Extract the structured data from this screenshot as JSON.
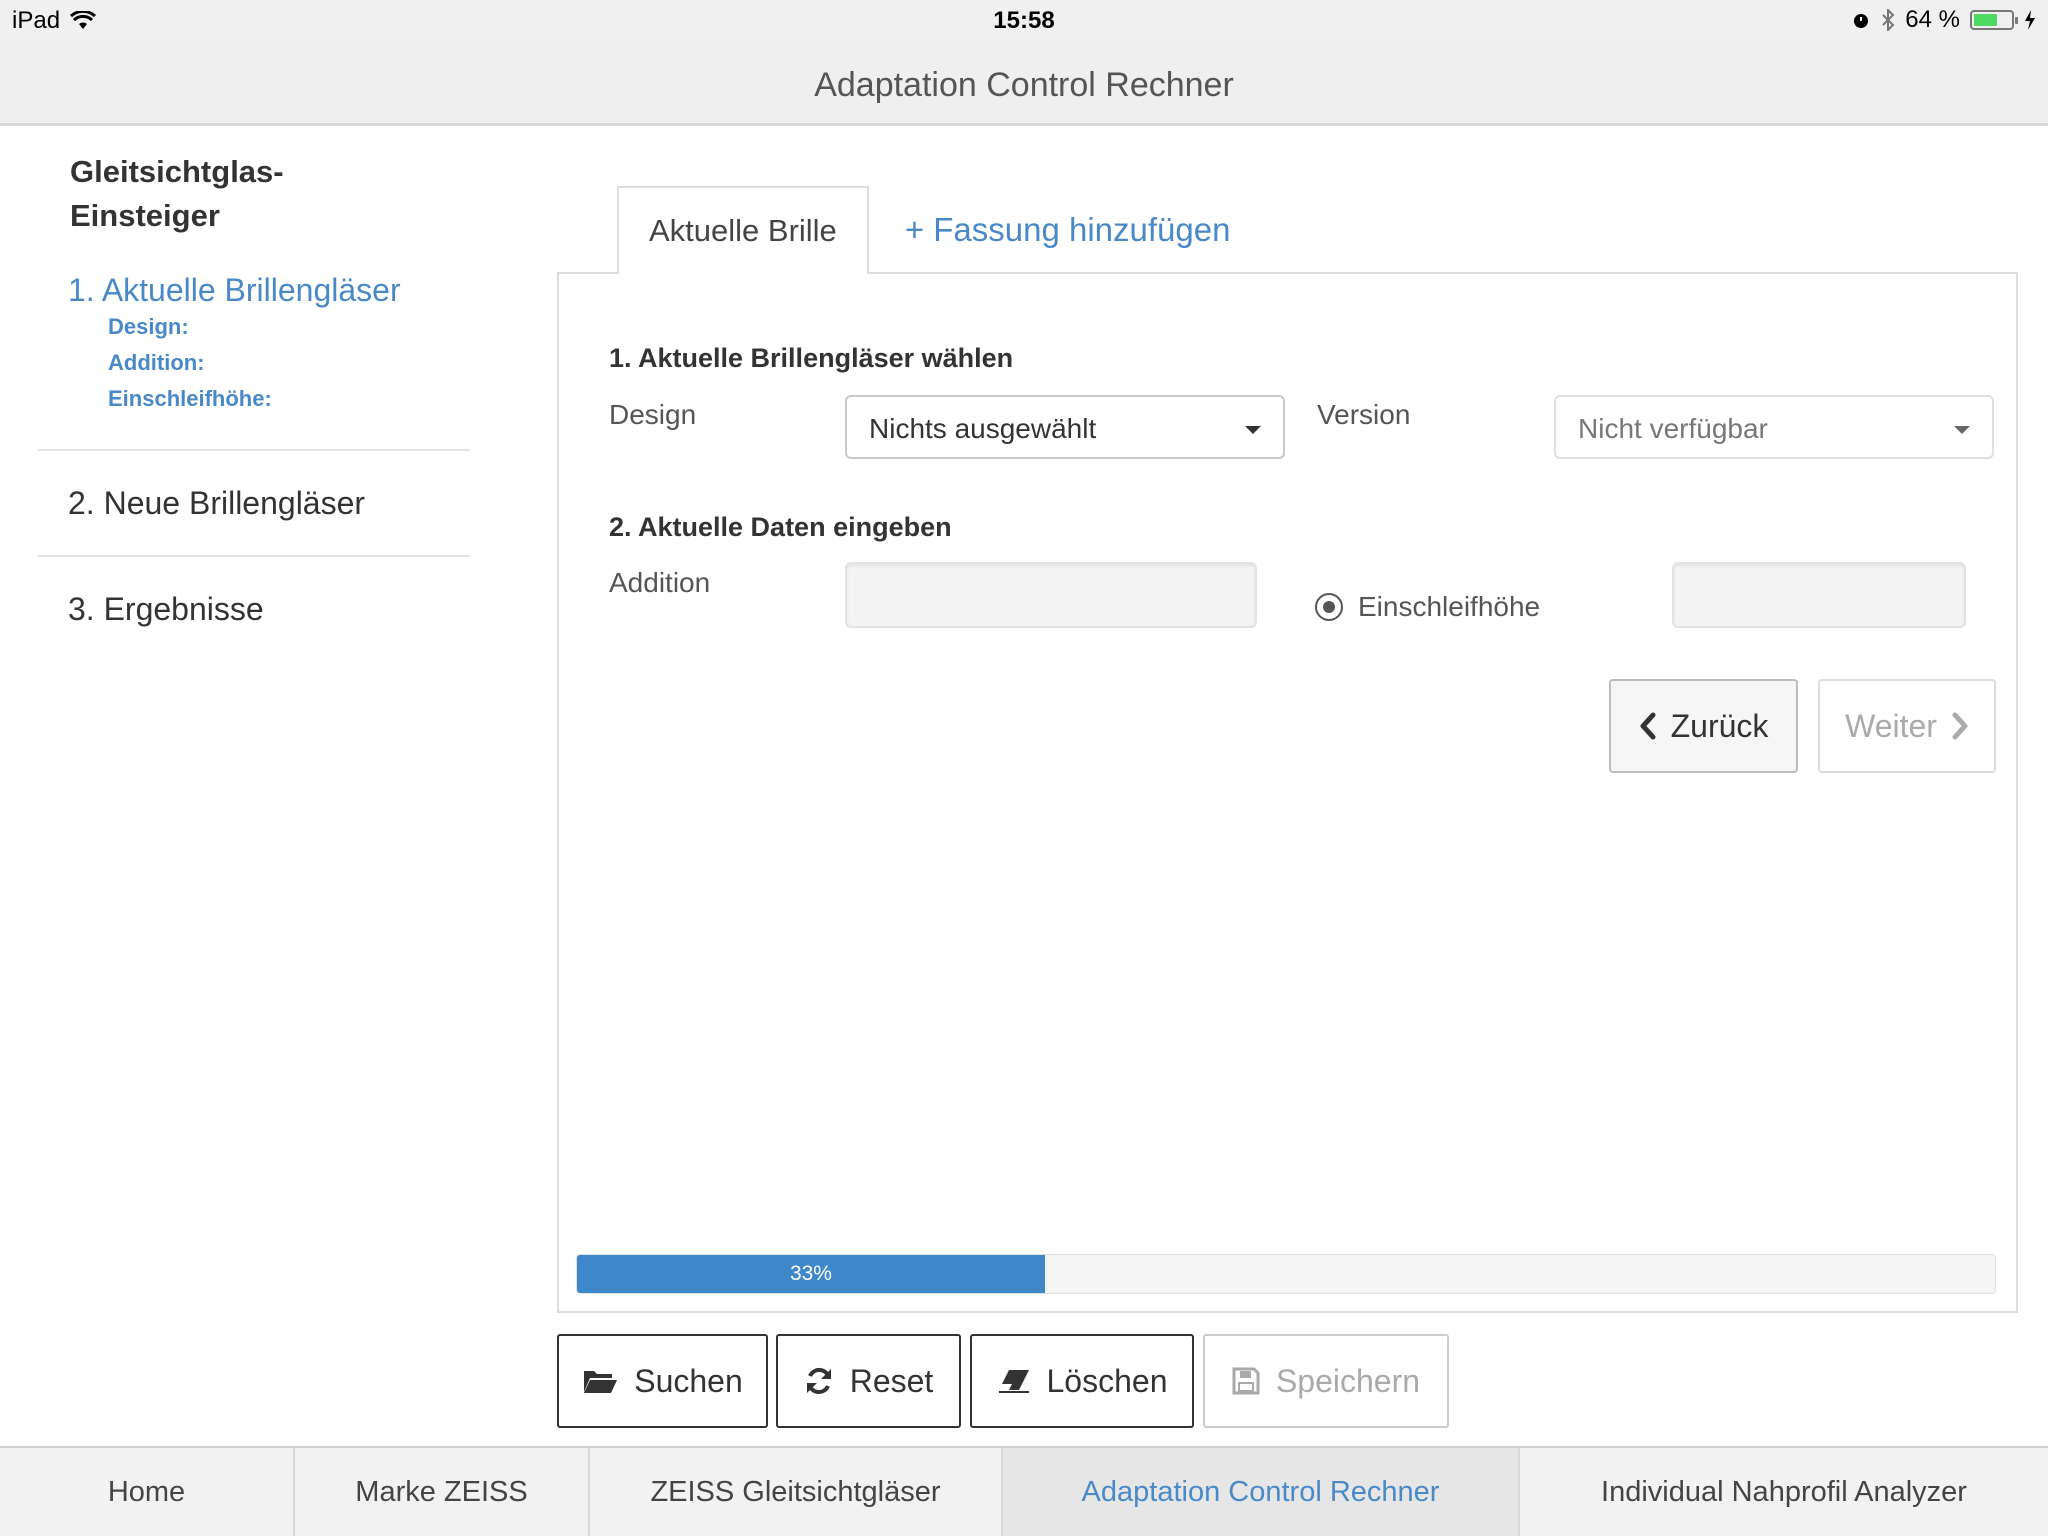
{
  "status_bar": {
    "device": "iPad",
    "time": "15:58",
    "battery": "64 %",
    "battery_level": 0.64,
    "icons": [
      "wifi-icon",
      "alarm-icon",
      "bluetooth-icon",
      "battery-icon",
      "charging-icon"
    ]
  },
  "app": {
    "title": "Adaptation Control Rechner"
  },
  "sidebar": {
    "heading": "Gleitsichtglas-\nEinsteiger",
    "active_step": {
      "label": "1. Aktuelle Brillengläser",
      "details": [
        "Design:",
        "Addition:",
        "Einschleifhöhe:"
      ]
    },
    "steps": [
      "2. Neue Brillengläser",
      "3. Ergebnisse"
    ]
  },
  "tabs": {
    "active": "Aktuelle Brille",
    "add": "+ Fassung hinzufügen"
  },
  "form": {
    "section1_title": "1. Aktuelle Brillengläser wählen",
    "design_label": "Design",
    "design_value": "Nichts ausgewählt",
    "version_label": "Version",
    "version_value": "Nicht verfügbar",
    "section2_title": "2. Aktuelle Daten eingeben",
    "addition_label": "Addition",
    "addition_value": "",
    "einschleif_label": "Einschleifhöhe",
    "einschleif_value": ""
  },
  "navigation": {
    "back": "Zurück",
    "next": "Weiter"
  },
  "progress": {
    "percent": 33,
    "label": "33%"
  },
  "actions": {
    "search": "Suchen",
    "reset": "Reset",
    "delete": "Löschen",
    "save": "Speichern"
  },
  "bottom_tabs": [
    "Home",
    "Marke ZEISS",
    "ZEISS Gleitsichtgläser",
    "Adaptation Control Rechner",
    "Individual Nahprofil Analyzer"
  ],
  "colors": {
    "accent": "#4a89c8",
    "progress": "#3f87cb",
    "battery": "#4cd964"
  }
}
